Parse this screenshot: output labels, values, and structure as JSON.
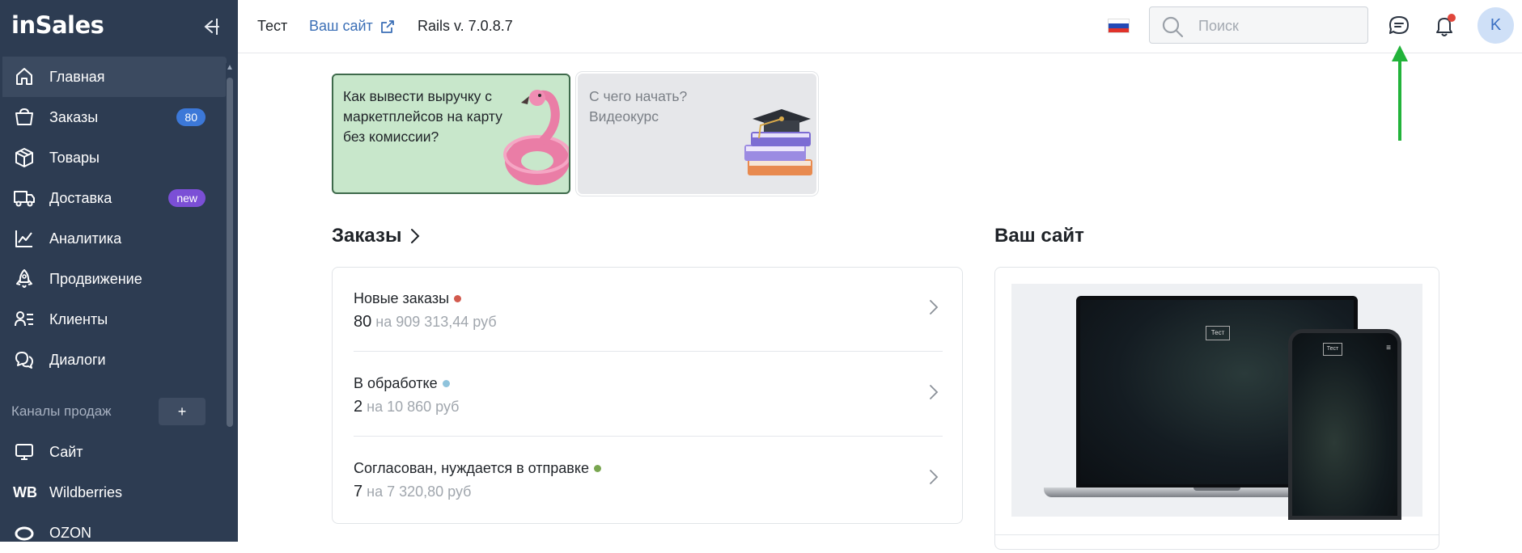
{
  "sidebar": {
    "logo": "inSales",
    "items": [
      {
        "label": "Главная",
        "icon": "home-icon",
        "active": true
      },
      {
        "label": "Заказы",
        "icon": "basket-icon",
        "badge": "80"
      },
      {
        "label": "Товары",
        "icon": "box-icon"
      },
      {
        "label": "Доставка",
        "icon": "truck-icon",
        "badge": "new"
      },
      {
        "label": "Аналитика",
        "icon": "chart-icon"
      },
      {
        "label": "Продвижение",
        "icon": "rocket-icon"
      },
      {
        "label": "Клиенты",
        "icon": "clients-icon"
      },
      {
        "label": "Диалоги",
        "icon": "dialogs-icon"
      }
    ],
    "channels_title": "Каналы продаж",
    "channels_add": "+",
    "channels": [
      {
        "label": "Сайт",
        "icon": "monitor-icon"
      },
      {
        "label": "Wildberries",
        "icon_text": "WB"
      },
      {
        "label": "OZON",
        "icon": "ozon-icon"
      }
    ]
  },
  "topbar": {
    "shop_name": "Тест",
    "site_link": "Ваш сайт",
    "rails_version": "Rails v. 7.0.8.7",
    "search_placeholder": "Поиск",
    "avatar_letter": "K",
    "flag_colors": [
      "#ffffff",
      "#2349b6",
      "#e0322a"
    ]
  },
  "promos": [
    {
      "text": "Как вывести выручку с маркетплейсов на карту без комиссии?"
    },
    {
      "text": "С чего начать? Видеокурс"
    }
  ],
  "orders": {
    "title": "Заказы",
    "rows": [
      {
        "label": "Новые заказы",
        "count": "80",
        "sum": "на 909 313,44 руб",
        "dot_color": "#d25a4e"
      },
      {
        "label": "В обработке",
        "count": "2",
        "sum": "на 10 860 руб",
        "dot_color": "#8fc3dc"
      },
      {
        "label": "Согласован, нуждается в отправке",
        "count": "7",
        "sum": "на 7 320,80 руб",
        "dot_color": "#79a650"
      }
    ]
  },
  "site": {
    "title": "Ваш сайт",
    "laptop_label": "Тест",
    "phone_label": "Тест"
  },
  "colors": {
    "sidebar_bg": "#2d3c52",
    "accent_blue": "#3c78d8",
    "annotation_arrow": "#22b33a"
  }
}
